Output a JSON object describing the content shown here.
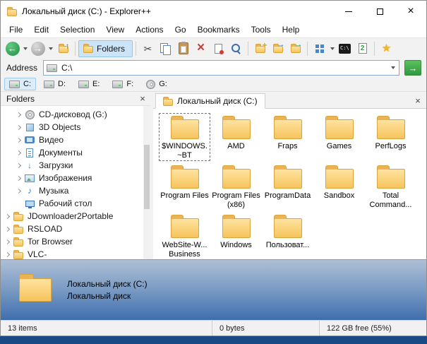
{
  "window": {
    "title": "Локальный диск (C:) - Explorer++"
  },
  "menu": {
    "items": [
      "File",
      "Edit",
      "Selection",
      "View",
      "Actions",
      "Go",
      "Bookmarks",
      "Tools",
      "Help"
    ]
  },
  "toolbar": {
    "items": [
      {
        "type": "button",
        "name": "back",
        "icon": "back-icon"
      },
      {
        "type": "dropdown",
        "name": "back-history"
      },
      {
        "type": "button",
        "name": "forward",
        "icon": "forward-icon"
      },
      {
        "type": "dropdown",
        "name": "forward-history"
      },
      {
        "type": "button",
        "name": "up",
        "icon": "up-icon"
      },
      {
        "type": "separator"
      },
      {
        "type": "button",
        "name": "folders",
        "icon": "folders-icon",
        "label": "Folders",
        "active": true
      },
      {
        "type": "separator"
      },
      {
        "type": "button",
        "name": "cut",
        "icon": "cut-icon"
      },
      {
        "type": "button",
        "name": "copy",
        "icon": "copy-icon"
      },
      {
        "type": "button",
        "name": "paste",
        "icon": "paste-icon"
      },
      {
        "type": "button",
        "name": "delete",
        "icon": "delete-icon"
      },
      {
        "type": "button",
        "name": "properties",
        "icon": "properties-icon"
      },
      {
        "type": "button",
        "name": "search",
        "icon": "search-icon"
      },
      {
        "type": "separator"
      },
      {
        "type": "button",
        "name": "new-folder",
        "icon": "new-folder-icon"
      },
      {
        "type": "button",
        "name": "copy-to",
        "icon": "copy-to-icon"
      },
      {
        "type": "button",
        "name": "move-to",
        "icon": "move-to-icon"
      },
      {
        "type": "separator"
      },
      {
        "type": "button",
        "name": "views",
        "icon": "views-icon"
      },
      {
        "type": "dropdown",
        "name": "views-menu"
      },
      {
        "type": "button",
        "name": "command-prompt",
        "icon": "command-prompt-icon"
      },
      {
        "type": "button",
        "name": "duplicate-tab",
        "icon": "new-tab-icon"
      },
      {
        "type": "separator"
      },
      {
        "type": "button",
        "name": "add-bookmark",
        "icon": "bookmark-star-icon"
      }
    ]
  },
  "address": {
    "label": "Address",
    "value": "C:\\"
  },
  "drives": {
    "items": [
      {
        "label": "C:",
        "icon": "drive-icon",
        "active": true
      },
      {
        "label": "D:",
        "icon": "drive-icon",
        "active": false
      },
      {
        "label": "E:",
        "icon": "drive-icon",
        "active": false
      },
      {
        "label": "F:",
        "icon": "drive-icon",
        "active": false
      },
      {
        "label": "G:",
        "icon": "cd-icon",
        "active": false
      }
    ]
  },
  "tree": {
    "title": "Folders",
    "items": [
      {
        "label": "CD-дисковод (G:)",
        "icon": "cd-icon",
        "level": 1,
        "expandable": true
      },
      {
        "label": "3D Objects",
        "icon": "objects3d-icon",
        "level": 1,
        "expandable": true
      },
      {
        "label": "Видео",
        "icon": "video-icon",
        "level": 1,
        "expandable": true
      },
      {
        "label": "Документы",
        "icon": "documents-icon",
        "level": 1,
        "expandable": true
      },
      {
        "label": "Загрузки",
        "icon": "downloads-icon",
        "level": 1,
        "expandable": true
      },
      {
        "label": "Изображения",
        "icon": "pictures-icon",
        "level": 1,
        "expandable": true
      },
      {
        "label": "Музыка",
        "icon": "music-icon",
        "level": 1,
        "expandable": true
      },
      {
        "label": "Рабочий стол",
        "icon": "desktop-icon",
        "level": 1,
        "expandable": false
      },
      {
        "label": "JDownloader2Portable",
        "icon": "folder-icon",
        "level": 0,
        "expandable": true
      },
      {
        "label": "RSLOAD",
        "icon": "folder-icon",
        "level": 0,
        "expandable": true
      },
      {
        "label": "Tor Browser",
        "icon": "folder-icon",
        "level": 0,
        "expandable": true
      },
      {
        "label": "VLC-",
        "icon": "folder-icon",
        "level": 0,
        "expandable": true
      }
    ]
  },
  "tab": {
    "label": "Локальный диск (C:)"
  },
  "files": {
    "items": [
      {
        "name": "$WINDOWS.~BT",
        "selected": true
      },
      {
        "name": "AMD",
        "selected": false
      },
      {
        "name": "Fraps",
        "selected": false
      },
      {
        "name": "Games",
        "selected": false
      },
      {
        "name": "PerfLogs",
        "selected": false
      },
      {
        "name": "Program Files",
        "selected": false
      },
      {
        "name": "Program Files (x86)",
        "selected": false
      },
      {
        "name": "ProgramData",
        "selected": false
      },
      {
        "name": "Sandbox",
        "selected": false
      },
      {
        "name": "Total Command...",
        "selected": false
      },
      {
        "name": "WebSite-W... Business",
        "selected": false
      },
      {
        "name": "Windows",
        "selected": false
      },
      {
        "name": "Пользоват...",
        "selected": false
      }
    ]
  },
  "info": {
    "title": "Локальный диск (C:)",
    "subtitle": "Локальный диск"
  },
  "status": {
    "items": "13 items",
    "size": "0 bytes",
    "free": "122 GB free (55%)"
  },
  "colors": {
    "accent_blue": "#2f7fd6",
    "folder_yellow": "#f6c45c",
    "folders_toggle_bg": "#cce4f7",
    "nav_green": "#2e9e4f",
    "info_gradient_top": "#aebfd4",
    "info_gradient_bottom": "#3f6eae",
    "taskbar_blue": "#1a4a85"
  }
}
